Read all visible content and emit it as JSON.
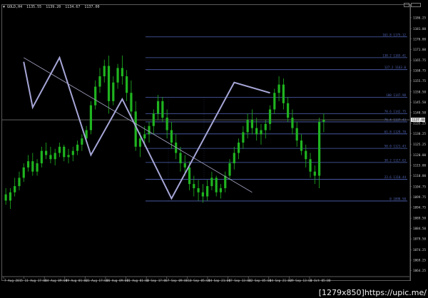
{
  "window": {
    "title_symbol": "▼ GOLD,H4",
    "ohlc": [
      "1135.55",
      "1139.20",
      "1134.67",
      "1137.00"
    ]
  },
  "colors": {
    "background": "#000000",
    "grid_line": "#46466e",
    "candle": "#1fb41f",
    "trend": "#9a9ab8",
    "zigzag": "#a6a6d8",
    "fib": "#5064b4",
    "text": "#d0d0d0",
    "price_marker": "#e8e8e8"
  },
  "fibonacci": {
    "levels": [
      {
        "label": "161.8  1175.12",
        "value": 1177.0
      },
      {
        "label": "138.2  1165.41",
        "value": 1167.0
      },
      {
        "label": "127.2  1163.0",
        "value": 1161.2
      },
      {
        "label": "100  1147.90",
        "value": 1147.9
      },
      {
        "label": "78.6  1142.75",
        "value": 1139.9
      },
      {
        "label": "76.4  1137.43",
        "value": 1136.0
      },
      {
        "label": "61.8  1129.78",
        "value": 1130.2
      },
      {
        "label": "50.0  1121.43",
        "value": 1123.2
      },
      {
        "label": "38.2  1117.63",
        "value": 1116.4
      },
      {
        "label": "23.6  1110.44",
        "value": 1108.3
      },
      {
        "label": "0  1098.50",
        "value": 1097.8
      }
    ]
  },
  "current_price": "1137.00",
  "price_axis": {
    "labels": [
      "1186.25",
      "1181.00",
      "1176.00",
      "1171.00",
      "1165.75",
      "1160.75",
      "1155.75",
      "1150.50",
      "1145.50",
      "1140.50",
      "1135.25",
      "1130.25",
      "1125.25",
      "1120.00",
      "1115.00",
      "1110.00",
      "1104.75",
      "1099.75",
      "1094.75",
      "1089.50",
      "1084.50",
      "1079.50",
      "1074.25",
      "1069.25",
      "1064.25"
    ],
    "min": 1062.0,
    "max": 1190.0
  },
  "time_axis": {
    "labels": [
      "7 Aug 2015",
      "11 Aug 17:00",
      "14 Aug 09:00",
      "19 Aug 01:00",
      "21 Aug 17:00",
      "26 Aug 09:00",
      "31 Aug 01:00",
      "2 Sep 17:00",
      "7 Sep 09:00",
      "10 Sep 05:00",
      "14 Sep 21:00",
      "17 Sep 13:00",
      "22 Sep 05:00",
      "24 Sep 21:00",
      "29 Sep 13:00",
      "2 Oct 05:00"
    ]
  },
  "watermark": "[1279x850]https://upic.me/",
  "chart_data": {
    "type": "candlestick",
    "series": [
      {
        "values": [
          [
            1101,
            1104,
            1096,
            1098
          ],
          [
            1098,
            1104,
            1094,
            1102
          ],
          [
            1102,
            1109,
            1100,
            1105
          ],
          [
            1105,
            1112,
            1103,
            1109
          ],
          [
            1109,
            1116,
            1107,
            1114
          ],
          [
            1114,
            1120,
            1112,
            1117
          ],
          [
            1117,
            1121,
            1110,
            1112
          ],
          [
            1112,
            1118,
            1110,
            1116
          ],
          [
            1116,
            1124,
            1114,
            1122
          ],
          [
            1122,
            1126,
            1118,
            1120
          ],
          [
            1120,
            1124,
            1116,
            1118
          ],
          [
            1118,
            1123,
            1115,
            1121
          ],
          [
            1121,
            1126,
            1119,
            1124
          ],
          [
            1124,
            1125,
            1117,
            1119
          ],
          [
            1119,
            1123,
            1116,
            1120
          ],
          [
            1120,
            1124,
            1117,
            1122
          ],
          [
            1122,
            1127,
            1120,
            1125
          ],
          [
            1125,
            1130,
            1122,
            1128
          ],
          [
            1128,
            1134,
            1126,
            1132
          ],
          [
            1132,
            1146,
            1130,
            1144
          ],
          [
            1144,
            1156,
            1142,
            1153
          ],
          [
            1153,
            1162,
            1150,
            1158
          ],
          [
            1158,
            1166,
            1155,
            1163
          ],
          [
            1163,
            1168,
            1140,
            1146
          ],
          [
            1146,
            1158,
            1144,
            1155
          ],
          [
            1155,
            1164,
            1152,
            1162
          ],
          [
            1162,
            1168,
            1154,
            1158
          ],
          [
            1158,
            1161,
            1146,
            1150
          ],
          [
            1150,
            1156,
            1138,
            1141
          ],
          [
            1141,
            1146,
            1122,
            1124
          ],
          [
            1124,
            1131,
            1119,
            1128
          ],
          [
            1128,
            1134,
            1124,
            1130
          ],
          [
            1130,
            1136,
            1126,
            1134
          ],
          [
            1134,
            1142,
            1130,
            1140
          ],
          [
            1140,
            1149,
            1137,
            1146
          ],
          [
            1146,
            1148,
            1136,
            1138
          ],
          [
            1138,
            1142,
            1128,
            1132
          ],
          [
            1132,
            1136,
            1123,
            1126
          ],
          [
            1126,
            1130,
            1118,
            1121
          ],
          [
            1121,
            1124,
            1112,
            1116
          ],
          [
            1116,
            1120,
            1110,
            1114
          ],
          [
            1114,
            1117,
            1103,
            1106
          ],
          [
            1106,
            1110,
            1100,
            1104
          ],
          [
            1104,
            1108,
            1098,
            1102
          ],
          [
            1102,
            1106,
            1097,
            1100
          ],
          [
            1100,
            1108,
            1098,
            1105
          ],
          [
            1105,
            1112,
            1103,
            1109
          ],
          [
            1109,
            1110,
            1100,
            1102
          ],
          [
            1102,
            1106,
            1099,
            1104
          ],
          [
            1104,
            1112,
            1102,
            1110
          ],
          [
            1110,
            1118,
            1108,
            1116
          ],
          [
            1116,
            1124,
            1113,
            1121
          ],
          [
            1121,
            1128,
            1118,
            1126
          ],
          [
            1126,
            1134,
            1123,
            1131
          ],
          [
            1131,
            1140,
            1128,
            1137
          ],
          [
            1137,
            1142,
            1130,
            1133
          ],
          [
            1133,
            1138,
            1127,
            1130
          ],
          [
            1130,
            1135,
            1125,
            1132
          ],
          [
            1132,
            1137,
            1128,
            1135
          ],
          [
            1135,
            1144,
            1132,
            1142
          ],
          [
            1142,
            1152,
            1140,
            1150
          ],
          [
            1150,
            1158,
            1146,
            1154
          ],
          [
            1154,
            1157,
            1142,
            1145
          ],
          [
            1145,
            1148,
            1136,
            1138
          ],
          [
            1138,
            1142,
            1130,
            1133
          ],
          [
            1133,
            1136,
            1124,
            1127
          ],
          [
            1127,
            1130,
            1120,
            1122
          ],
          [
            1122,
            1125,
            1114,
            1118
          ],
          [
            1118,
            1121,
            1109,
            1112
          ],
          [
            1112,
            1115,
            1106,
            1110
          ],
          [
            1110,
            1138,
            1104,
            1136
          ],
          [
            1136,
            1140,
            1131,
            1137
          ]
        ]
      }
    ],
    "zigzag": [
      [
        4,
        1165
      ],
      [
        6,
        1143
      ],
      [
        12,
        1167
      ],
      [
        19,
        1120
      ],
      [
        26,
        1147
      ],
      [
        37,
        1099
      ],
      [
        51,
        1155
      ],
      [
        59,
        1150
      ]
    ],
    "trendline": [
      [
        4,
        1167
      ],
      [
        55,
        1102
      ]
    ]
  }
}
